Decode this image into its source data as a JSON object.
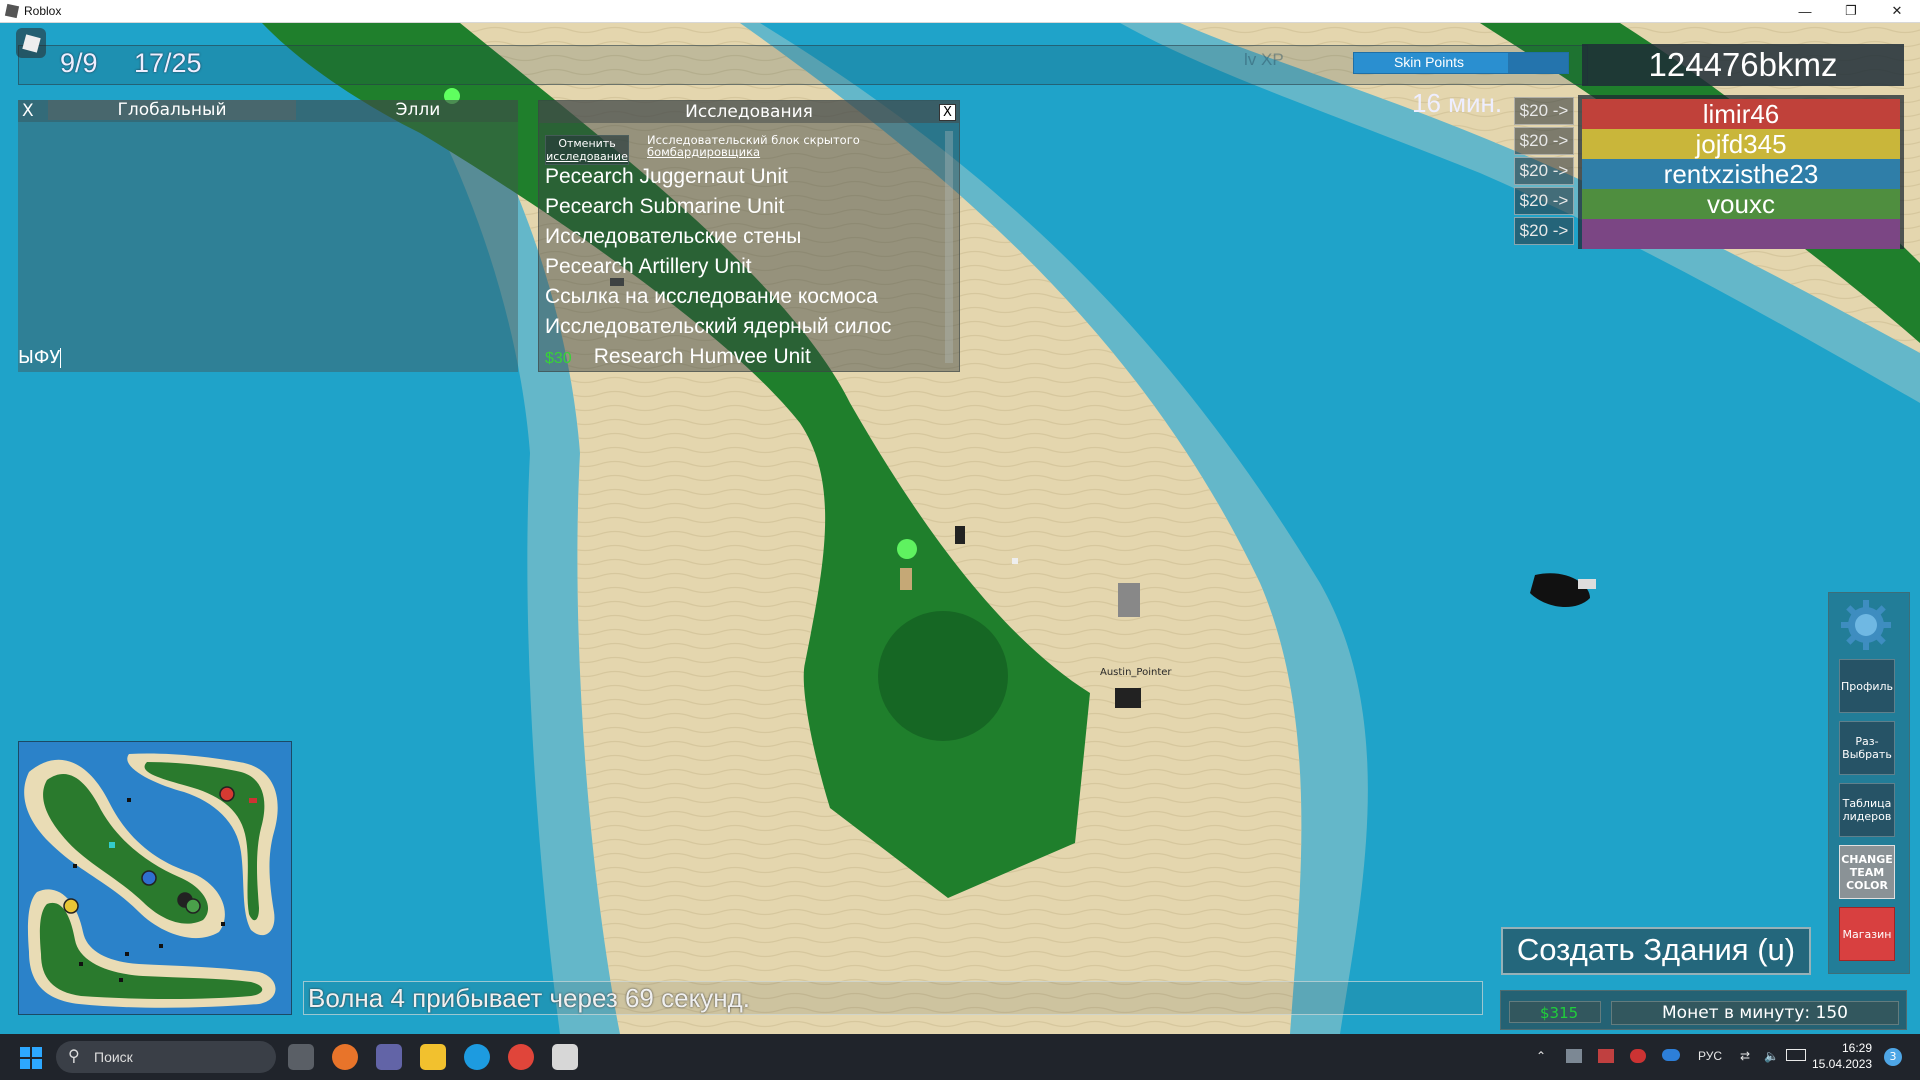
{
  "window": {
    "title": "Roblox",
    "controls": [
      "—",
      "❐",
      "✕"
    ]
  },
  "hud": {
    "units_count": "9/9",
    "buildings_count": "17/25",
    "xp_text": "lv XP",
    "skin_points_label": "Skin Points",
    "username": "124476bkmz",
    "timer": "16 мин."
  },
  "players": [
    {
      "name": "limir46",
      "color": "#c0413a",
      "price": "$20 ->"
    },
    {
      "name": "jojfd345",
      "color": "#c9b63a",
      "price": "$20 ->"
    },
    {
      "name": "rentxzisthe23",
      "color": "#2f7ea8",
      "price": "$20 ->"
    },
    {
      "name": "vouxc",
      "color": "#4f8e3f",
      "price": "$20 ->"
    },
    {
      "name": "",
      "color": "#7b4684",
      "price": "$20 ->"
    }
  ],
  "chat": {
    "close_label": "X",
    "tab_global": "Глобальный",
    "tab_elly": "Элли",
    "input_value": "ЫФУ"
  },
  "research": {
    "title": "Исследования",
    "close_label": "X",
    "cancel_label_line1": "Отменить",
    "cancel_label_line2": "исследование",
    "note_line1": "Исследовательский блок скрытого",
    "note_line2": "бомбардировщика",
    "items": [
      {
        "label": "Pecearch Juggernaut Unit",
        "cost": ""
      },
      {
        "label": "Pecearch Submarine Unit",
        "cost": ""
      },
      {
        "label": "Исследовательские стены",
        "cost": ""
      },
      {
        "label": "Pecearch Artillery Unit",
        "cost": ""
      },
      {
        "label": "Ссылка на исследование космоса",
        "cost": ""
      },
      {
        "label": "Исследовательский ядерный силос",
        "cost": ""
      },
      {
        "label": "Research Humvee Unit",
        "cost": "$30"
      }
    ]
  },
  "wave": {
    "text": "Волна 4 прибывает через 69 секунд."
  },
  "build": {
    "button_label": "Создать Здания (u)",
    "money": "$315",
    "per_minute": "Монет в минуту: 150"
  },
  "sidemenu": {
    "settings": "",
    "profile": "Профиль",
    "disband": "Раз-Выбрать",
    "leaderboard": "Таблица лидеров",
    "change_team_color": "CHANGE TEAM COLOR",
    "shop": "Магазин"
  },
  "world_labels": {
    "npc_name": "Austin_Pointer"
  },
  "taskbar": {
    "search_placeholder": "Поиск",
    "lang": "РУС",
    "time": "16:29",
    "date": "15.04.2023",
    "notifications": "3"
  },
  "colors": {
    "water": "#1fa3c9",
    "sand": "#e4d6ae",
    "grass": "#1f7f2c",
    "dark_grass": "#0f6a20",
    "accent_green": "#37d337"
  }
}
